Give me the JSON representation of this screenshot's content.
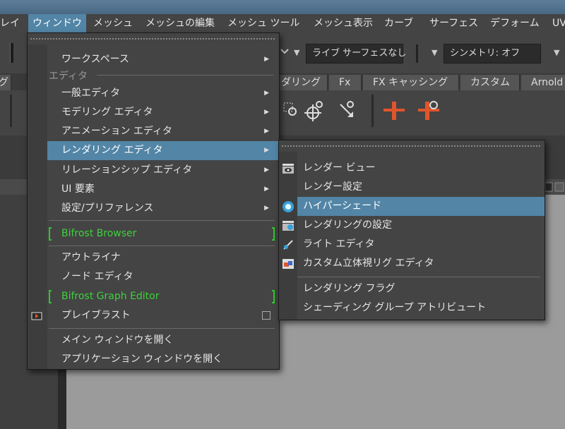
{
  "menubar": [
    "レイ",
    "ウィンドウ",
    "メッシュ",
    "メッシュの編集",
    "メッシュ ツール",
    "メッシュ表示",
    "カーブ",
    "サーフェス",
    "デフォーム",
    "UV"
  ],
  "statusline": {
    "surface_field": "ライブ サーフェスなし",
    "symmetry_field": "シンメトリ: オフ"
  },
  "shelf_tabs": [
    "グ",
    "ダリング",
    "Fx",
    "FX キャッシング",
    "カスタム",
    "Arnold"
  ],
  "window_menu": {
    "workspace": "ワークスペース",
    "section_editors": "エディタ",
    "items": [
      "一般エディタ",
      "モデリング エディタ",
      "アニメーション エディタ",
      "レンダリング エディタ",
      "リレーションシップ エディタ",
      "UI 要素",
      "設定/プリファレンス"
    ],
    "bifrost_browser": "Bifrost Browser",
    "outliner": "アウトライナ",
    "node_editor": "ノード エディタ",
    "bifrost_graph": "Bifrost Graph Editor",
    "playblast": "プレイブラスト",
    "open_main": "メイン ウィンドウを開く",
    "open_app": "アプリケーション ウィンドウを開く"
  },
  "render_submenu": {
    "items": [
      "レンダー ビュー",
      "レンダー設定",
      "ハイパーシェード",
      "レンダリングの設定",
      "ライト エディタ",
      "カスタム立体視リグ エディタ"
    ],
    "flags": "レンダリング フラグ",
    "shading_group": "シェーディング グループ アトリビュート"
  },
  "colors": {
    "highlight": "#5285a6",
    "bifrost_green": "#3cd23c",
    "shelf_orange": "#e0552b"
  }
}
